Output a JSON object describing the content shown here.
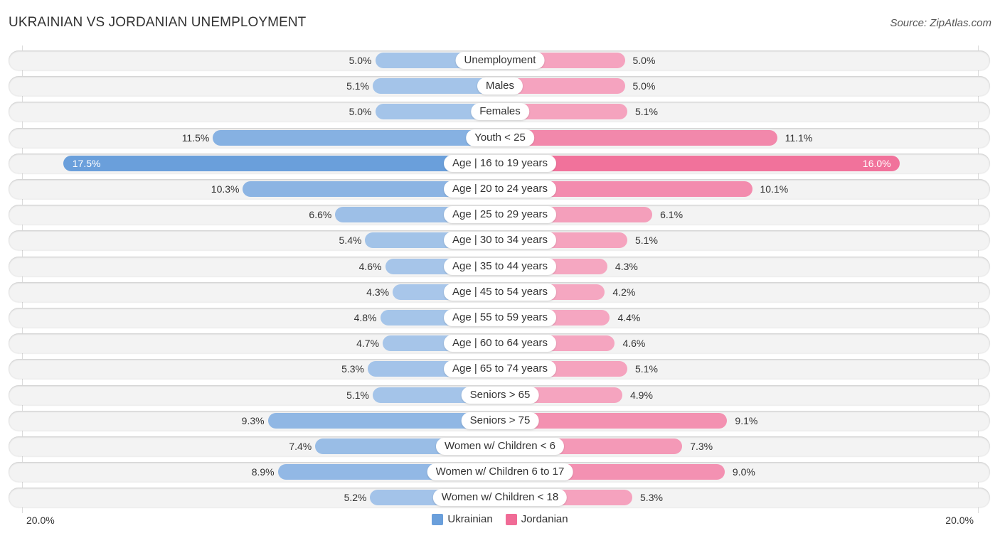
{
  "header": {
    "title": "UKRAINIAN VS JORDANIAN UNEMPLOYMENT",
    "source": "Source: ZipAtlas.com"
  },
  "colors": {
    "ukrainian": "#6a9fdb",
    "ukrainian_light": "#a9c7ea",
    "jordanian": "#f06b96",
    "jordanian_light": "#f5a8c2"
  },
  "axis": {
    "left_label": "20.0%",
    "right_label": "20.0%"
  },
  "legend": [
    {
      "label": "Ukrainian",
      "color": "#6a9fdb"
    },
    {
      "label": "Jordanian",
      "color": "#f06b96"
    }
  ],
  "chart_data": {
    "type": "bar",
    "orientation": "horizontal-diverging",
    "title": "UKRAINIAN VS JORDANIAN UNEMPLOYMENT",
    "xlim": [
      -20,
      20
    ],
    "unit": "%",
    "categories": [
      "Unemployment",
      "Males",
      "Females",
      "Youth < 25",
      "Age | 16 to 19 years",
      "Age | 20 to 24 years",
      "Age | 25 to 29 years",
      "Age | 30 to 34 years",
      "Age | 35 to 44 years",
      "Age | 45 to 54 years",
      "Age | 55 to 59 years",
      "Age | 60 to 64 years",
      "Age | 65 to 74 years",
      "Seniors > 65",
      "Seniors > 75",
      "Women w/ Children < 6",
      "Women w/ Children 6 to 17",
      "Women w/ Children < 18"
    ],
    "series": [
      {
        "name": "Ukrainian",
        "side": "left",
        "values": [
          5.0,
          5.1,
          5.0,
          11.5,
          17.5,
          10.3,
          6.6,
          5.4,
          4.6,
          4.3,
          4.8,
          4.7,
          5.3,
          5.1,
          9.3,
          7.4,
          8.9,
          5.2
        ],
        "labels": [
          "5.0%",
          "5.1%",
          "5.0%",
          "11.5%",
          "17.5%",
          "10.3%",
          "6.6%",
          "5.4%",
          "4.6%",
          "4.3%",
          "4.8%",
          "4.7%",
          "5.3%",
          "5.1%",
          "9.3%",
          "7.4%",
          "8.9%",
          "5.2%"
        ]
      },
      {
        "name": "Jordanian",
        "side": "right",
        "values": [
          5.0,
          5.0,
          5.1,
          11.1,
          16.0,
          10.1,
          6.1,
          5.1,
          4.3,
          4.2,
          4.4,
          4.6,
          5.1,
          4.9,
          9.1,
          7.3,
          9.0,
          5.3
        ],
        "labels": [
          "5.0%",
          "5.0%",
          "5.1%",
          "11.1%",
          "16.0%",
          "10.1%",
          "6.1%",
          "5.1%",
          "4.3%",
          "4.2%",
          "4.4%",
          "4.6%",
          "5.1%",
          "4.9%",
          "9.1%",
          "7.3%",
          "9.0%",
          "5.3%"
        ]
      }
    ],
    "legend_position": "bottom-center",
    "grid": false
  }
}
